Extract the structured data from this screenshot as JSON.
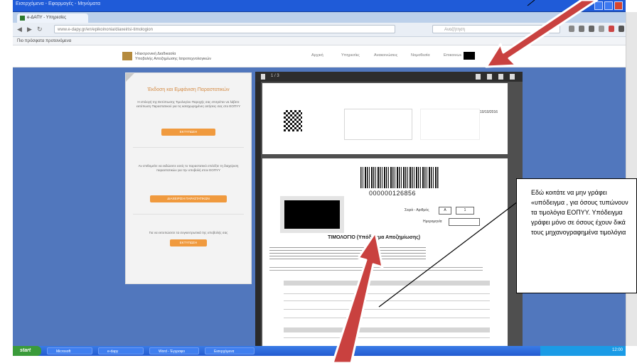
{
  "browser": {
    "window_title": "Εισερχόμενα - Εφαρμογές - Μηνύματα",
    "tab_title": "e-ΔΑΠΥ - Υπηρεσίες",
    "url": "www.e-dapy.gr/en/epikoinonia/diaxeirisi-timologion",
    "search_placeholder": "Αναζήτηση",
    "bookmarks_label": "Πιο πρόσφατα προτεινόμενα"
  },
  "site": {
    "logo_text_line1": "Ηλεκτρονική Διαδικασία",
    "logo_text_line2": "Υποβολής Αποζημίωσης Ιατροτεχνολογικών",
    "nav": [
      "Αρχική",
      "Υπηρεσίες",
      "Ανακοινώσεις",
      "Νομοθεσία",
      "Επικοινωνία"
    ]
  },
  "left_card": {
    "heading": "Έκδοση και Εμφάνιση Παραστατικών",
    "text1": "Η επιλογή της Εκτύπωσης Τιμολογίου Παροχής σας επιτρέπει να λάβετε εκτύπωση Παραστατικού για τις καταχωρημένες αιτήσεις σας στο ΕΟΠΥΥ",
    "button1": "ΕΚΤΥΠΩΣΗ",
    "text2": "Αν επιθυμείτε να εκδώσετε εσείς το παραστατικό επιλέξτε τη διαχείριση παραστατικών για την υποβολή στον ΕΟΠΥΥ",
    "button2": "ΔΙΑΧΕΙΡΙΣΗ ΠΑΡΑΣΤΑΤΙΚΩΝ",
    "text3": "Για να εκτυπώσετε τα συγκεντρωτικά της υποβολής σας",
    "button3": "ΕΚΤΥΠΩΣΗ"
  },
  "pdf": {
    "toolbar_text": "1 / 3",
    "page1_date": "10/10/2016",
    "barcode_number": "000000126856",
    "series_label": "Σειρά - Αριθμός",
    "series_value": "Α",
    "series_number": "1",
    "date_label": "Ημερομηνία",
    "doc_title": "ΤΙΜΟΛΟΓΙΟ (Υπόδειγμα Αποζημίωσης)"
  },
  "callout": {
    "text": "Εδώ κοιτάτε να μην γράφει «υπόδειγμα , για όσους τυπώνουν τα τιμολόγια ΕΟΠΥΥ. Υπόδειγμα γράφει μόνο σε όσους έχουν δικά τους μηχανογραφημένα τιμολόγια"
  },
  "taskbar": {
    "start_label": "start",
    "tasks": [
      "Microsoft",
      "e-dapy",
      "Word - Έγγραφο",
      "Εισερχόμενα"
    ],
    "clock": "12:00"
  },
  "colors": {
    "arrow": "#c9413f",
    "accent_orange": "#f09a3e",
    "page_bg": "#5177bd"
  }
}
